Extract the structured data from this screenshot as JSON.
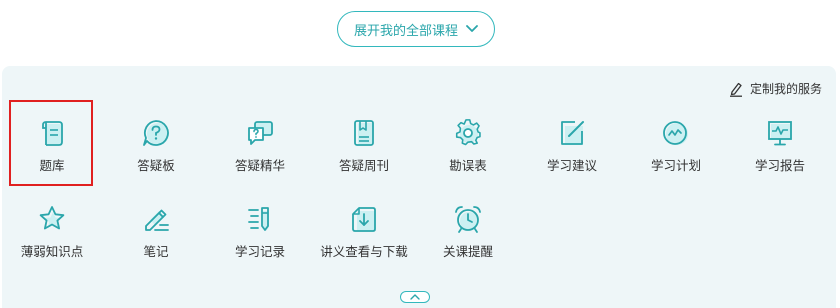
{
  "expand_button": {
    "label": "展开我的全部课程",
    "icon": "chevron-down-icon"
  },
  "custom_service": {
    "label": "定制我的服务",
    "icon": "edit-icon"
  },
  "accent_color": "#33b8bd",
  "highlight_color": "#e02020",
  "tiles": [
    {
      "label": "题库",
      "icon": "scroll-icon"
    },
    {
      "label": "答疑板",
      "icon": "question-bubble-icon"
    },
    {
      "label": "答疑精华",
      "icon": "chat-question-icon"
    },
    {
      "label": "答疑周刊",
      "icon": "bookmark-book-icon"
    },
    {
      "label": "勘误表",
      "icon": "gear-icon"
    },
    {
      "label": "学习建议",
      "icon": "pencil-box-icon"
    },
    {
      "label": "学习计划",
      "icon": "pulse-circle-icon"
    },
    {
      "label": "学习报告",
      "icon": "chart-board-icon"
    },
    {
      "label": "薄弱知识点",
      "icon": "star-icon"
    },
    {
      "label": "笔记",
      "icon": "pen-note-icon"
    },
    {
      "label": "学习记录",
      "icon": "list-pen-icon"
    },
    {
      "label": "讲义查看与下载",
      "icon": "download-doc-icon"
    },
    {
      "label": "关课提醒",
      "icon": "alarm-clock-icon"
    }
  ],
  "collapse_button": {
    "icon": "chevron-up-icon"
  }
}
